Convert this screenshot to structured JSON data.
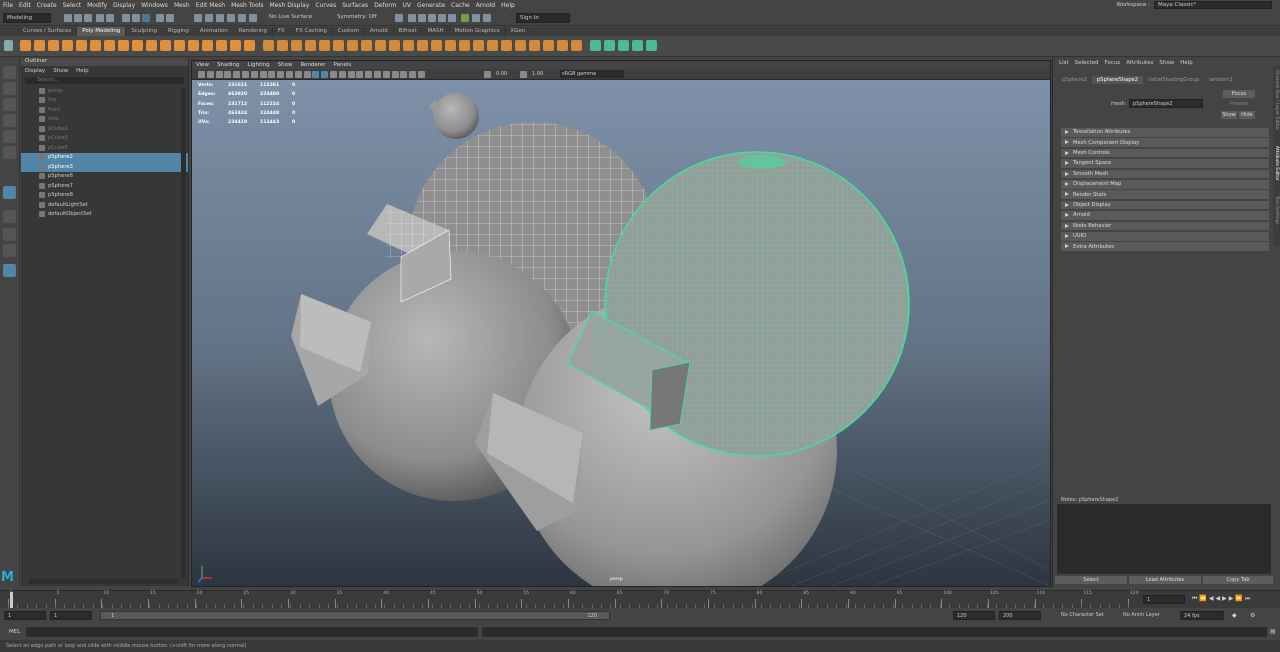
{
  "menubar": {
    "items": [
      "File",
      "Edit",
      "Create",
      "Select",
      "Modify",
      "Display",
      "Windows",
      "Mesh",
      "Edit Mesh",
      "Mesh Tools",
      "Mesh Display",
      "Curves",
      "Surfaces",
      "Deform",
      "UV",
      "Generate",
      "Cache",
      "Arnold",
      "Help"
    ],
    "workspace_label": "Workspace :",
    "workspace_value": "Maya Classic*"
  },
  "statusline": {
    "mode": "Modeling",
    "live_surface": "No Live Surface",
    "symmetry": "Symmetry: Off",
    "sign_in": "Sign In"
  },
  "shelf_tabs": [
    "Curves / Surfaces",
    "Poly Modeling",
    "Sculpting",
    "Rigging",
    "Animation",
    "Rendering",
    "FX",
    "FX Caching",
    "Custom",
    "Arnold",
    "Bifrost",
    "MASH",
    "Motion Graphics",
    "XGen"
  ],
  "shelf_active": "Poly Modeling",
  "outliner": {
    "title": "Outliner",
    "menu": [
      "Display",
      "Show",
      "Help"
    ],
    "search_placeholder": "Search...",
    "items": [
      {
        "label": "persp",
        "dim": true,
        "sel": false
      },
      {
        "label": "top",
        "dim": true,
        "sel": false
      },
      {
        "label": "front",
        "dim": true,
        "sel": false
      },
      {
        "label": "side",
        "dim": true,
        "sel": false
      },
      {
        "label": "pCube1",
        "dim": true,
        "sel": false
      },
      {
        "label": "pCube3",
        "dim": true,
        "sel": false
      },
      {
        "label": "pCube5",
        "dim": true,
        "sel": false
      },
      {
        "label": "pSphere2",
        "dim": false,
        "sel": true
      },
      {
        "label": "pSphere3",
        "dim": false,
        "sel": true
      },
      {
        "label": "pSphere6",
        "dim": false,
        "sel": false
      },
      {
        "label": "pSphere7",
        "dim": false,
        "sel": false
      },
      {
        "label": "pSphere8",
        "dim": false,
        "sel": false
      },
      {
        "label": "defaultLightSet",
        "dim": false,
        "sel": false
      },
      {
        "label": "defaultObjectSet",
        "dim": false,
        "sel": false
      }
    ]
  },
  "viewport": {
    "menu": [
      "View",
      "Shading",
      "Lighting",
      "Show",
      "Renderer",
      "Panels"
    ],
    "exposure": "0.00",
    "gamma": "1.00",
    "colorspace": "sRGB gamma",
    "camera_label": "persp",
    "hud": [
      {
        "k": "Verts:",
        "a": "231621",
        "b": "112361",
        "c": "0"
      },
      {
        "k": "Edges:",
        "a": "463920",
        "b": "224480",
        "c": "0"
      },
      {
        "k": "Faces:",
        "a": "231712",
        "b": "112224",
        "c": "0"
      },
      {
        "k": "Tris:",
        "a": "463424",
        "b": "224448",
        "c": "0"
      },
      {
        "k": "UVs:",
        "a": "234419",
        "b": "113443",
        "c": "0"
      }
    ]
  },
  "attribute_editor": {
    "menu": [
      "List",
      "Selected",
      "Focus",
      "Attributes",
      "Show",
      "Help"
    ],
    "tabs": [
      "pSphere2",
      "pSphereShape2",
      "initialShadingGroup",
      "lambert1"
    ],
    "active_tab": "pSphereShape2",
    "mesh_label": "mesh:",
    "mesh_value": "pSphereShape2",
    "focus": "Focus",
    "presets": "Presets",
    "show": "Show",
    "hide": "Hide",
    "sections": [
      "Tessellation Attributes",
      "Mesh Component Display",
      "Mesh Controls",
      "Tangent Space",
      "Smooth Mesh",
      "Displacement Map",
      "Render Stats",
      "Object Display",
      "Arnold",
      "Node Behavior",
      "UUID",
      "Extra Attributes"
    ],
    "notes_label": "Notes: pSphereShape2",
    "buttons": [
      "Select",
      "Load Attributes",
      "Copy Tab"
    ],
    "side_tabs": [
      "Channel Box / Layer Editor",
      "Attribute Editor",
      "Tool Settings"
    ]
  },
  "timeline": {
    "ticks": [
      "1",
      "5",
      "10",
      "15",
      "20",
      "25",
      "30",
      "35",
      "40",
      "45",
      "50",
      "55",
      "60",
      "65",
      "70",
      "75",
      "80",
      "85",
      "90",
      "95",
      "100",
      "105",
      "110",
      "115",
      "120"
    ],
    "current_frame": "1"
  },
  "range": {
    "start": "1",
    "inner_start": "1",
    "slider_start": "1",
    "slider_end": "120",
    "inner_end": "120",
    "end": "200",
    "character_set": "No Character Set",
    "anim_layer": "No Anim Layer",
    "fps": "24 fps"
  },
  "cmdline": {
    "label": "MEL"
  },
  "help_text": "Select an edge path or loop and slide with middle mouse button. (+shift for more along normal)",
  "colors": {
    "accent": "#5285a6",
    "wire_highlight": "#3fe0a0",
    "logo": "#22b0d9",
    "shelf_icon": "#e0903a"
  }
}
